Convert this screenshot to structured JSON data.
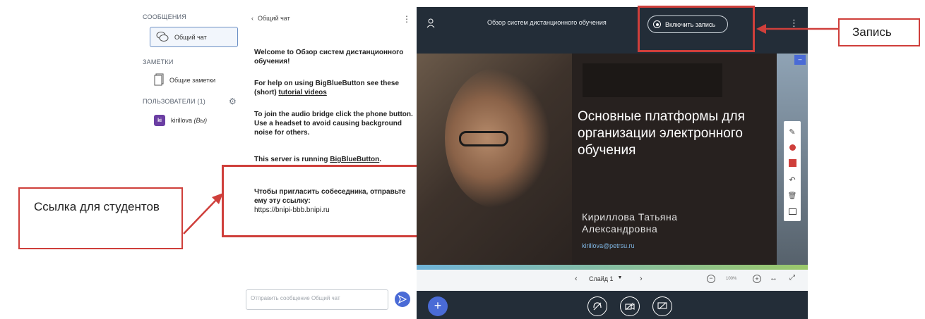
{
  "sidebar": {
    "messages_heading": "СООБЩЕНИЯ",
    "public_chat_label": "Общий чат",
    "notes_heading": "ЗАМЕТКИ",
    "shared_notes_label": "Общие заметки",
    "users_heading": "ПОЛЬЗОВАТЕЛИ (1)",
    "user": {
      "initials": "ki",
      "name": "kirillova",
      "suffix": "(Вы)"
    }
  },
  "chat": {
    "back_label": "Общий чат",
    "welcome_prefix": "Welcome to ",
    "welcome_title": "Обзор систем дистанционного обучения",
    "welcome_suffix": "!",
    "help_prefix": "For help on using BigBlueButton see these (short) ",
    "help_link": "tutorial videos",
    "audio_text": "To join the audio bridge click the phone button. Use a headset to avoid causing background noise for others.",
    "server_prefix": "This server is running ",
    "server_link": "BigBlueButton",
    "server_suffix": ".",
    "invite_text": "Чтобы пригласить собеседника, отправьте ему эту ссылку:",
    "invite_url": "https://bnipi-bbb.bnipi.ru",
    "input_placeholder": "Отправить сообщение Общий чат"
  },
  "presentation": {
    "meeting_title": "Обзор систем дистанционного обучения",
    "record_button": "Включить запись",
    "slide_title": "Основные платформы для организации электронного обучения",
    "author_name": "Кириллова Татьяна Александровна",
    "author_email": "kirillova@petrsu.ru",
    "slide_selector": "Слайд 1",
    "zoom_level": "100%"
  },
  "annotations": {
    "record_label": "Запись",
    "students_link_label": "Ссылка для студентов"
  },
  "colors": {
    "accent": "#cf3f3b",
    "dark_bg": "#232d38",
    "brand_blue": "#4a6bd6"
  }
}
